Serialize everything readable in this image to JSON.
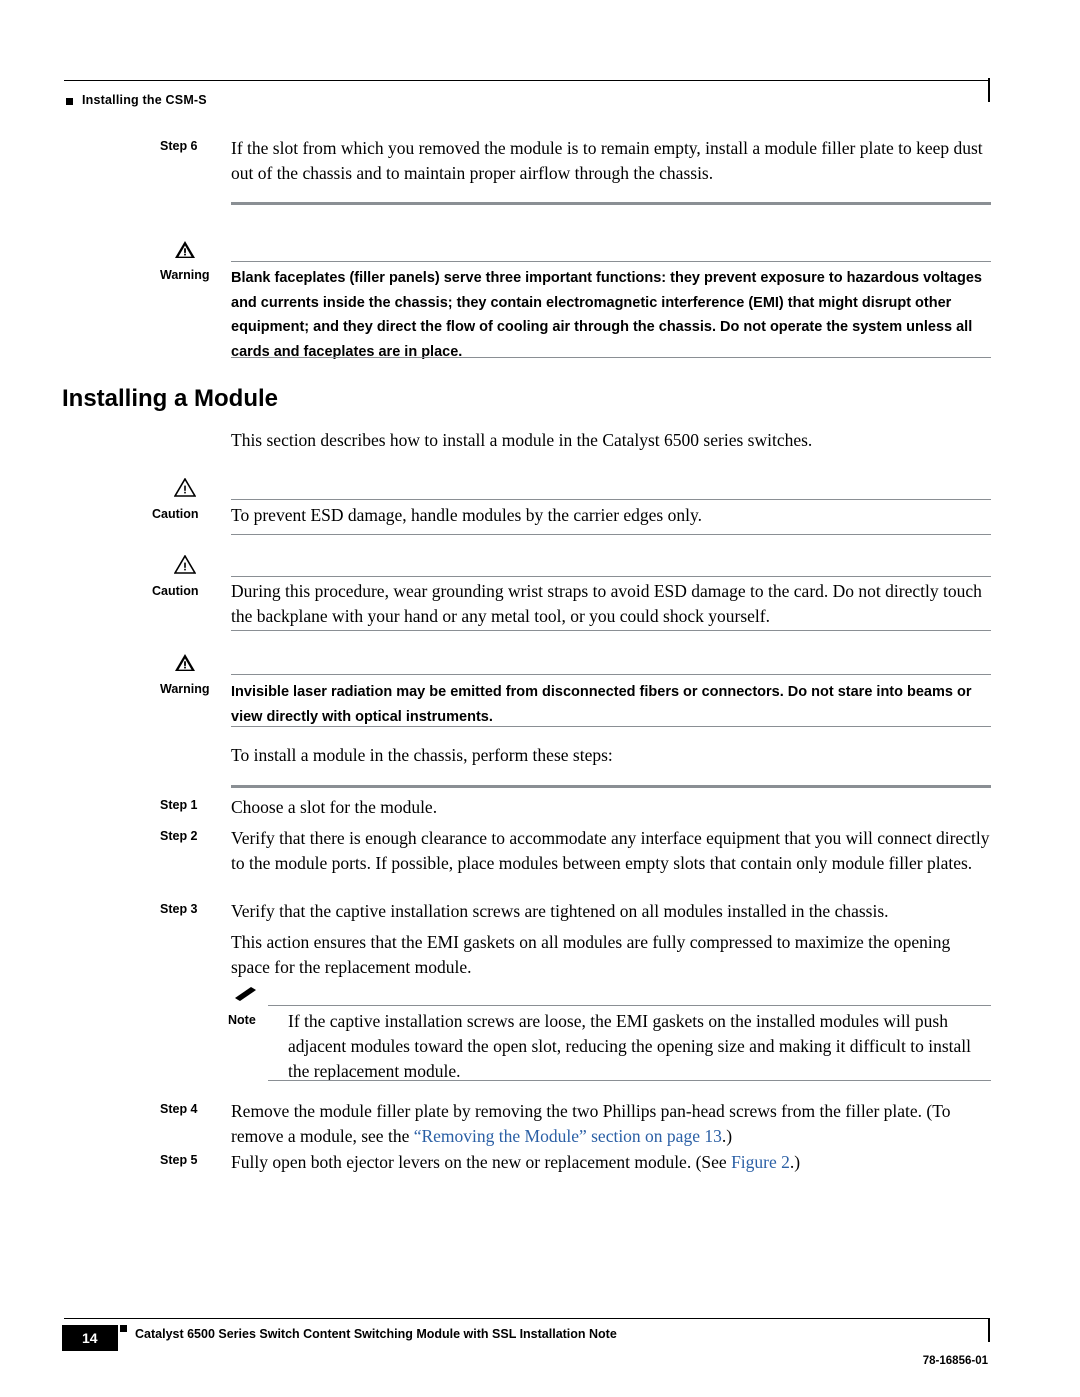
{
  "header": {
    "running_head": "Installing the CSM-S"
  },
  "steps_top": {
    "step6_label": "Step 6",
    "step6_text": "If the slot from which you removed the module is to remain empty, install a module filler plate to keep dust out of the chassis and to maintain proper airflow through the chassis."
  },
  "warning1": {
    "label": "Warning",
    "icon": "warning-triangle-icon",
    "text": "Blank faceplates (filler panels) serve three important functions: they prevent exposure to hazardous voltages and currents inside the chassis; they contain electromagnetic interference (EMI) that might disrupt other equipment; and they direct the flow of cooling air through the chassis. Do not operate the system unless all cards and faceplates are in place."
  },
  "section": {
    "heading": "Installing a Module",
    "intro": "This section describes how to install a module in the Catalyst 6500 series switches."
  },
  "caution1": {
    "label": "Caution",
    "icon": "caution-triangle-icon",
    "text": "To prevent ESD damage, handle modules by the carrier edges only."
  },
  "caution2": {
    "label": "Caution",
    "icon": "caution-triangle-icon",
    "text": "During this procedure, wear grounding wrist straps to avoid ESD damage to the card. Do not directly touch the backplane with your hand or any metal tool, or you could shock yourself."
  },
  "warning2": {
    "label": "Warning",
    "icon": "warning-triangle-icon",
    "text": "Invisible laser radiation may be emitted from disconnected fibers or connectors. Do not stare into beams or view directly with optical instruments."
  },
  "procedure": {
    "lead_in": "To install a module in the chassis, perform these steps:",
    "steps": [
      {
        "label": "Step 1",
        "text": "Choose a slot for the module."
      },
      {
        "label": "Step 2",
        "text": "Verify that there is enough clearance to accommodate any interface equipment that you will connect directly to the module ports. If possible, place modules between empty slots that contain only module filler plates."
      },
      {
        "label": "Step 3",
        "text": "Verify that the captive installation screws are tightened on all modules installed in the chassis."
      }
    ],
    "step3_followup": "This action ensures that the EMI gaskets on all modules are fully compressed to maximize the opening space for the replacement module."
  },
  "note": {
    "label": "Note",
    "icon": "note-pencil-icon",
    "text": "If the captive installation screws are loose, the EMI gaskets on the installed modules will push adjacent modules toward the open slot, reducing the opening size and making it difficult to install the replacement module."
  },
  "steps_tail": {
    "step4_label": "Step 4",
    "step4_text_part1": "Remove the module filler plate by removing the two Phillips pan-head screws from the filler plate. (To remove a module, see the ",
    "step4_xref": "“Removing the Module” section on page 13",
    "step4_text_part2": ".)",
    "step5_label": "Step 5",
    "step5_text_part1": "Fully open both ejector levers on the new or replacement module. (See ",
    "step5_xref": "Figure 2",
    "step5_text_part2": ".)"
  },
  "footer": {
    "page_number": "14",
    "doc_title": "Catalyst 6500 Series Switch Content Switching Module with SSL Installation Note",
    "doc_number": "78-16856-01"
  },
  "colors": {
    "rule_gray": "#8a8f94",
    "xref_blue": "#2a5fa5",
    "text_black": "#000000"
  }
}
